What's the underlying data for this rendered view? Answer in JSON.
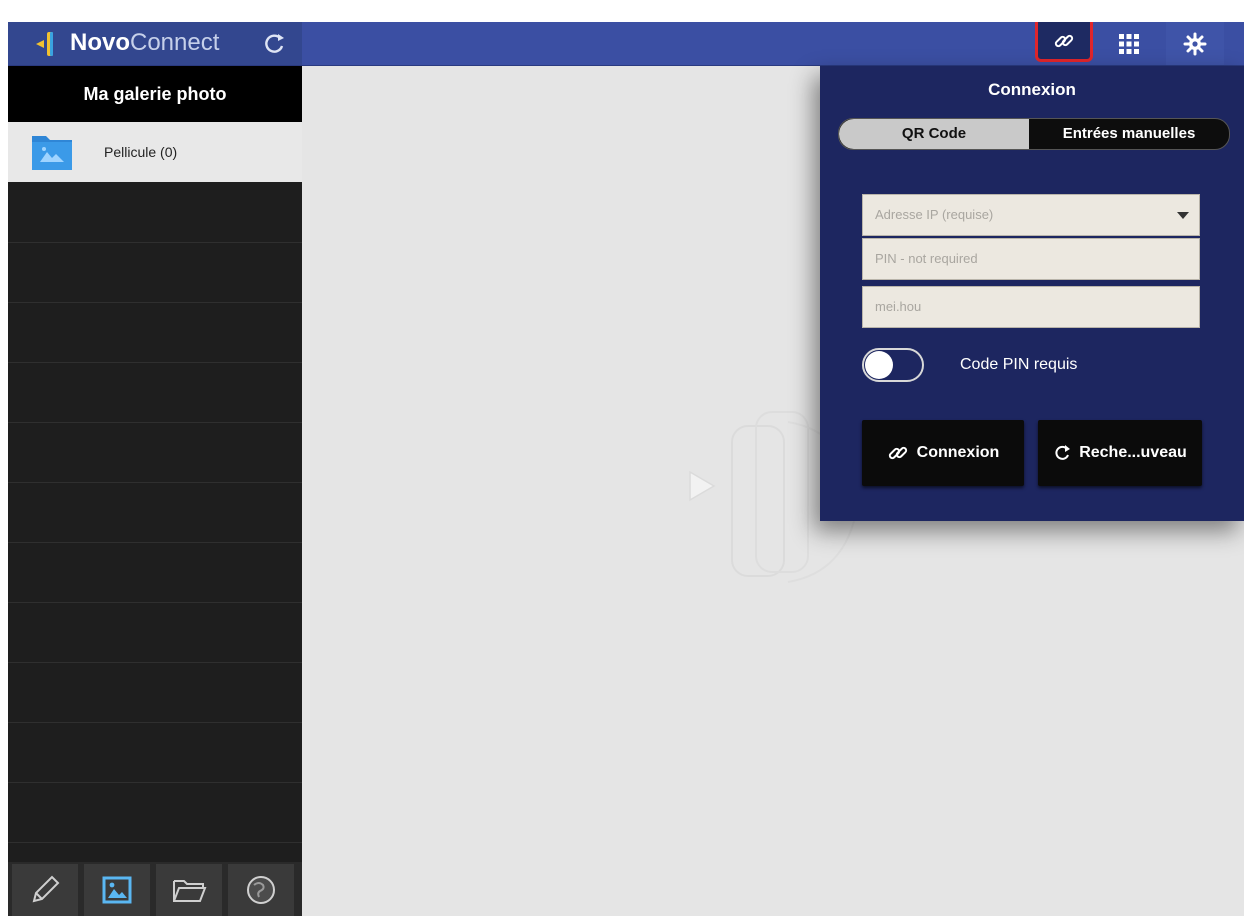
{
  "brand": {
    "bold": "Novo",
    "light": "Connect"
  },
  "colors": {
    "topbar": "#3b4fa3",
    "panel": "#1d2660",
    "highlight": "#e0252b"
  },
  "toolbar": {
    "refresh_icon": "refresh-icon",
    "link_icon": "link-icon",
    "apps_icon": "grid-icon",
    "settings_icon": "gear-icon"
  },
  "sidebar": {
    "header": "Ma galerie photo",
    "folder": {
      "label": "Pellicule (0)",
      "icon": "image-folder-icon"
    },
    "tabs": [
      {
        "icon": "pencil-icon"
      },
      {
        "icon": "image-icon",
        "active": true
      },
      {
        "icon": "folder-open-icon"
      },
      {
        "icon": "globe-icon"
      }
    ]
  },
  "panel": {
    "title": "Connexion",
    "segments": {
      "qr": "QR Code",
      "manual": "Entrées manuelles",
      "selected": "QR Code"
    },
    "fields": {
      "ip_placeholder": "Adresse IP (requise)",
      "pin_placeholder": "PIN - not required",
      "name_value": "mei.hou"
    },
    "toggle": {
      "label": "Code PIN requis",
      "on": false
    },
    "buttons": {
      "connect": "Connexion",
      "search": "Reche...uveau"
    }
  }
}
